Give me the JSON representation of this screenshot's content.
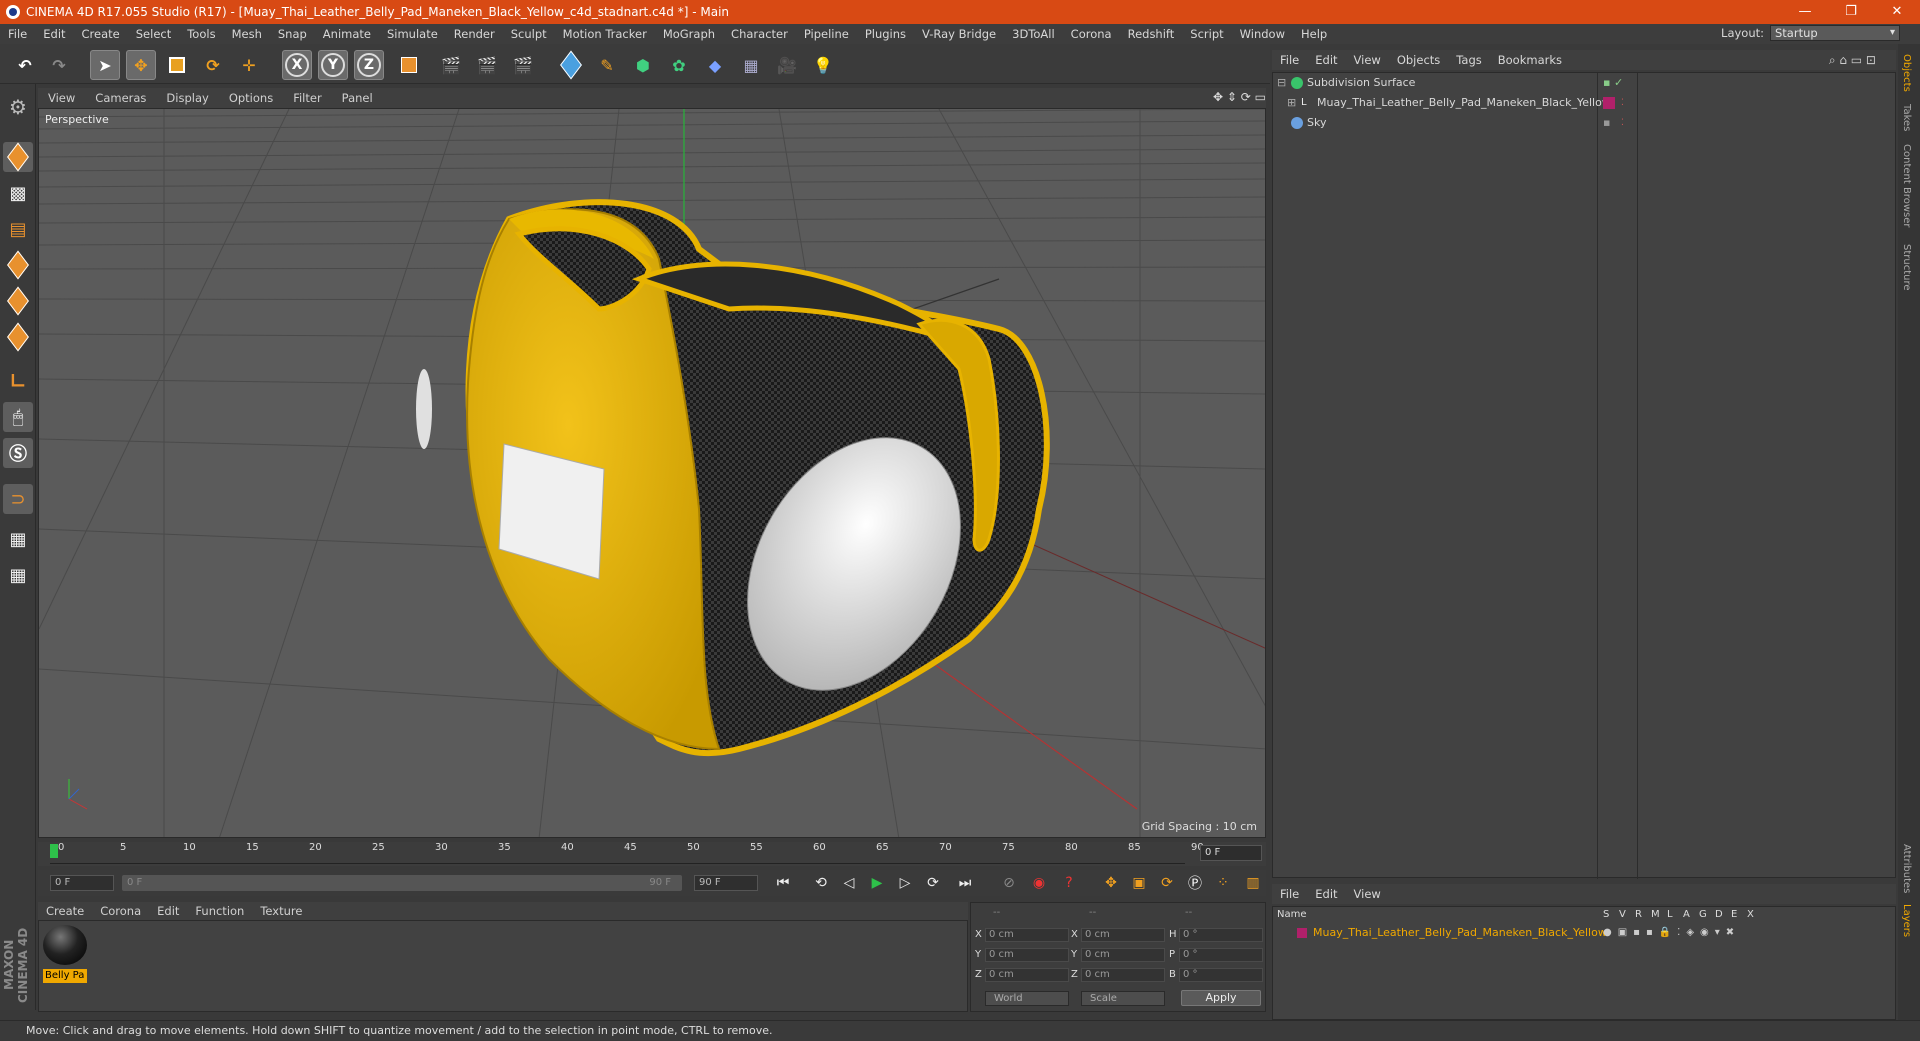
{
  "window": {
    "title": "CINEMA 4D R17.055 Studio (R17) - [Muay_Thai_Leather_Belly_Pad_Maneken_Black_Yellow_c4d_stadnart.c4d *] - Main",
    "controls": [
      "—",
      "❐",
      "✕"
    ]
  },
  "menubar": {
    "items": [
      "File",
      "Edit",
      "Create",
      "Select",
      "Tools",
      "Mesh",
      "Snap",
      "Animate",
      "Simulate",
      "Render",
      "Sculpt",
      "Motion Tracker",
      "MoGraph",
      "Character",
      "Pipeline",
      "Plugins",
      "V-Ray Bridge",
      "3DToAll",
      "Corona",
      "Redshift",
      "Script",
      "Window",
      "Help"
    ],
    "layout_label": "Layout:",
    "layout_value": "Startup"
  },
  "toolbar": {
    "axis_x": "X",
    "axis_y": "Y",
    "axis_z": "Z"
  },
  "viewport": {
    "menu": [
      "View",
      "Cameras",
      "Display",
      "Options",
      "Filter",
      "Panel"
    ],
    "label": "Perspective",
    "grid_spacing": "Grid Spacing : 10 cm",
    "nav_icons": "✥ ⇕ ⟳ ▭"
  },
  "timeline": {
    "ticks": [
      "0",
      "5",
      "10",
      "15",
      "20",
      "25",
      "30",
      "35",
      "40",
      "45",
      "50",
      "55",
      "60",
      "65",
      "70",
      "75",
      "80",
      "85",
      "90"
    ],
    "frame_end": "0 F",
    "start_field": "0 F",
    "range_start": "0 F",
    "range_end": "90 F",
    "end_field": "90 F"
  },
  "materials": {
    "menu": [
      "Create",
      "Corona",
      "Edit",
      "Function",
      "Texture"
    ],
    "items": [
      {
        "label": "Belly Pa"
      }
    ],
    "brand": "MAXON CINEMA 4D"
  },
  "coords": {
    "headers": [
      "--",
      "--",
      "--"
    ],
    "rows": [
      {
        "a": "X",
        "av": "0 cm",
        "b": "X",
        "bv": "0 cm",
        "c": "H",
        "cv": "0 °"
      },
      {
        "a": "Y",
        "av": "0 cm",
        "b": "Y",
        "bv": "0 cm",
        "c": "P",
        "cv": "0 °"
      },
      {
        "a": "Z",
        "av": "0 cm",
        "b": "Z",
        "bv": "0 cm",
        "c": "B",
        "cv": "0 °"
      }
    ],
    "mode1": "World",
    "mode2": "Scale",
    "apply": "Apply"
  },
  "objects": {
    "menu": [
      "File",
      "Edit",
      "View",
      "Objects",
      "Tags",
      "Bookmarks"
    ],
    "rows": [
      {
        "name": "Subdivision Surface",
        "icon_color": "#39c46b"
      },
      {
        "name": "Muay_Thai_Leather_Belly_Pad_Maneken_Black_Yellow",
        "icon_color": "#e0e0e0",
        "tag_color": "#b0206a"
      },
      {
        "name": "Sky",
        "icon_color": "#6aa0e0"
      }
    ]
  },
  "layers": {
    "menu": [
      "File",
      "Edit",
      "View"
    ],
    "header_name": "Name",
    "header_cols": [
      "S",
      "V",
      "R",
      "M",
      "L",
      "A",
      "G",
      "D",
      "E",
      "X"
    ],
    "rows": [
      {
        "name": "Muay_Thai_Leather_Belly_Pad_Maneken_Black_Yellow",
        "color": "#b0206a"
      }
    ]
  },
  "side_tabs": [
    "Objects",
    "Takes",
    "Content Browser",
    "Structure",
    "Attributes",
    "Layers"
  ],
  "status": "Move: Click and drag to move elements. Hold down SHIFT to quantize movement / add to the selection in point mode, CTRL to remove."
}
